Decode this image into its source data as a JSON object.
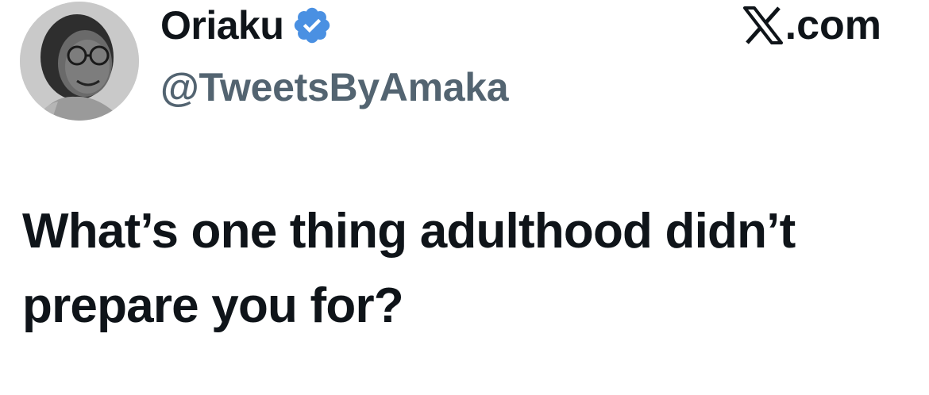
{
  "author": {
    "display_name": "Oriaku",
    "handle": "@TweetsByAmaka",
    "verified": true,
    "avatar_icon": "user-avatar-photo",
    "verified_icon": "verified-badge-icon"
  },
  "brand": {
    "label": ".com",
    "icon": "x-logo-icon"
  },
  "tweet": {
    "text": "What’s one thing adulthood didn’t prepare you for?"
  },
  "colors": {
    "text_primary": "#0f1419",
    "text_secondary": "#536471",
    "verified_blue": "#4a90e2",
    "background": "#ffffff"
  }
}
